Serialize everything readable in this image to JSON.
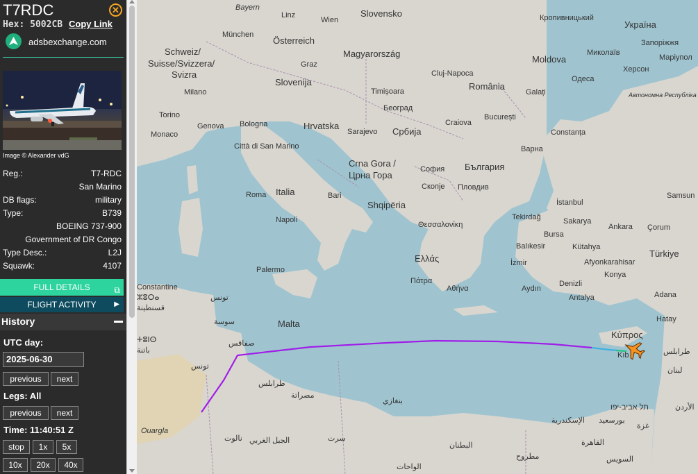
{
  "aircraft": {
    "callsign": "T7RDC",
    "hex_label": "Hex: 5002CB",
    "copy_link": "Copy Link",
    "site": "adsbexchange.com",
    "photo_credit": "Image © Alexander vdG"
  },
  "details": [
    {
      "key": "Reg.:",
      "value": "T7-RDC"
    },
    {
      "key": "",
      "value": "San Marino"
    },
    {
      "key": "DB flags:",
      "value": "military"
    },
    {
      "key": "Type:",
      "value": "B739"
    },
    {
      "key": "",
      "value": "BOEING 737-900"
    },
    {
      "key": "",
      "value": "Government of DR Congo"
    },
    {
      "key": "Type Desc.:",
      "value": "L2J"
    },
    {
      "key": "Squawk:",
      "value": "4107"
    }
  ],
  "buttons": {
    "full_details": "FULL DETAILS",
    "flight_activity": "FLIGHT ACTIVITY"
  },
  "history": {
    "title": "History",
    "utc_day_label": "UTC day:",
    "date_value": "2025-06-30",
    "prev": "previous",
    "next": "next",
    "legs_label": "Legs: All",
    "legs_prev": "previous",
    "legs_next": "next",
    "time_label": "Time: 11:40:51 Z",
    "speed_buttons": [
      "stop",
      "1x",
      "5x",
      "10x",
      "20x",
      "40x"
    ]
  },
  "map_labels": {
    "bayern": "Bayern",
    "linz": "Linz",
    "wien": "Wien",
    "slovensko": "Slovensko",
    "kropyvnytskyi": "Кропивницький",
    "ukraina": "Україна",
    "munchen": "München",
    "osterreich": "Österreich",
    "zaporizhzhia": "Запоріжжя",
    "schweiz": "Schweiz/",
    "suisse": "Suisse/Svizzera/",
    "svizra": "Svizra",
    "graz": "Graz",
    "magyarorszag": "Magyarország",
    "moldova": "Moldova",
    "mykolaiv": "Миколаїв",
    "mariupol": "Маріупол",
    "kherson": "Херсон",
    "slovenija": "Slovenija",
    "cluj": "Cluj-Napoca",
    "odesa": "Одеса",
    "milano": "Milano",
    "timisoara": "Timișoara",
    "romania": "România",
    "galati": "Galați",
    "crimea": "Автономна Республіка Крим",
    "torino": "Torino",
    "genova": "Genova",
    "bologna": "Bologna",
    "hrvatska": "Hrvatska",
    "beograd": "Београд",
    "craiova": "Craiova",
    "bucuresti": "București",
    "monaco": "Monaco",
    "sarajevo": "Sarajevo",
    "srbija": "Србија",
    "constanta": "Constanța",
    "san_marino": "Città di San Marino",
    "varna": "Варна",
    "crna_gora": "Crna Gora /",
    "crna_gora2": "Црна Гора",
    "sofia": "София",
    "bulgaria": "България",
    "skopje": "Скопје",
    "plovdiv": "Пловдив",
    "italia": "Italia",
    "roma": "Roma",
    "bari": "Bari",
    "shqiperia": "Shqipëria",
    "istanbul": "İstanbul",
    "samsun": "Samsun",
    "tekirdag": "Tekirdağ",
    "sakarya": "Sakarya",
    "ankara": "Ankara",
    "corum": "Çorum",
    "napoli": "Napoli",
    "thessaloniki": "Θεσσαλονίκη",
    "bursa": "Bursa",
    "balikesir": "Balıkesir",
    "kutahya": "Kütahya",
    "turkiye": "Türkiye",
    "ellada": "Ελλάς",
    "izmir": "İzmir",
    "afyon": "Afyonkarahisar",
    "palermo": "Palermo",
    "konya": "Konya",
    "constantine": "Constantine",
    "patra": "Πάτρα",
    "athina": "Αθήνα",
    "aydin": "Aydın",
    "denizli": "Denizli",
    "tunis": "تونس",
    "antalya": "Antalya",
    "adana": "Adana",
    "qasentina": "قسنطينة",
    "malta": "Malta",
    "sousse": "سوسة",
    "hatay": "Hatay",
    "kypros": "Κύπρος",
    "kibris": "Kıb",
    "sfax": "صفاقس",
    "tarabulus_lb": "طرابلس",
    "tounes": "تونس",
    "lubnan": "لبنان",
    "tarabulus_ly": "طرابلس",
    "misrata": "مصراتة",
    "benghazi": "بنغازي",
    "tel_aviv": "תל אביב-יפו",
    "alexandria": "الإسكندرية",
    "port_said": "بورسعيد",
    "gaza": "غزة",
    "urdun": "الأردن",
    "ouargla": "Ouargla",
    "nalut": "نالوت",
    "jabal": "الجبل الغربي",
    "sirte": "سرت",
    "cairo": "القاهرة",
    "suez": "السويس",
    "butnan": "البطنان",
    "matruh": "مطروح",
    "wahat": "الواحات",
    "berber": "ⵜⵓⵏⵙ",
    "batna": "باتنة",
    "zouara": "ⵣⵓⵔⴰ"
  }
}
